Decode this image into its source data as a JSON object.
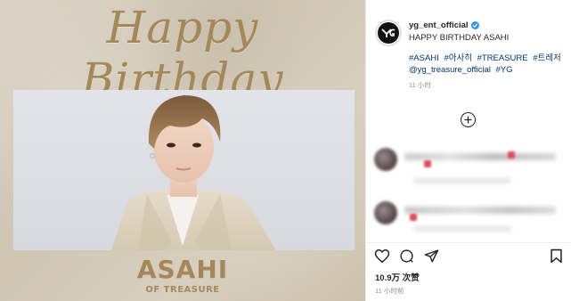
{
  "post": {
    "headline": "Happy Birthday",
    "name_big": "ASAHI",
    "name_small": "OF TREASURE"
  },
  "caption": {
    "username": "yg_ent_official",
    "text": "HAPPY BIRTHDAY ASAHI",
    "tags": [
      "#ASAHI",
      "#아사히",
      "#TREASURE",
      "#트레저",
      "@yg_treasure_official",
      "#YG"
    ],
    "time": "11 小时"
  },
  "footer": {
    "likes": "10.9万 次赞",
    "time": "11 小时前"
  },
  "icons": {
    "verified": "verified-badge-icon",
    "more": "plus-circle-icon",
    "like": "heart-icon",
    "comment": "comment-bubble-icon",
    "share": "paper-plane-icon",
    "save": "bookmark-icon"
  },
  "colors": {
    "gold": "#a5875a",
    "link": "#00376b",
    "verified": "#3897f0",
    "muted": "#8e8e8e"
  }
}
